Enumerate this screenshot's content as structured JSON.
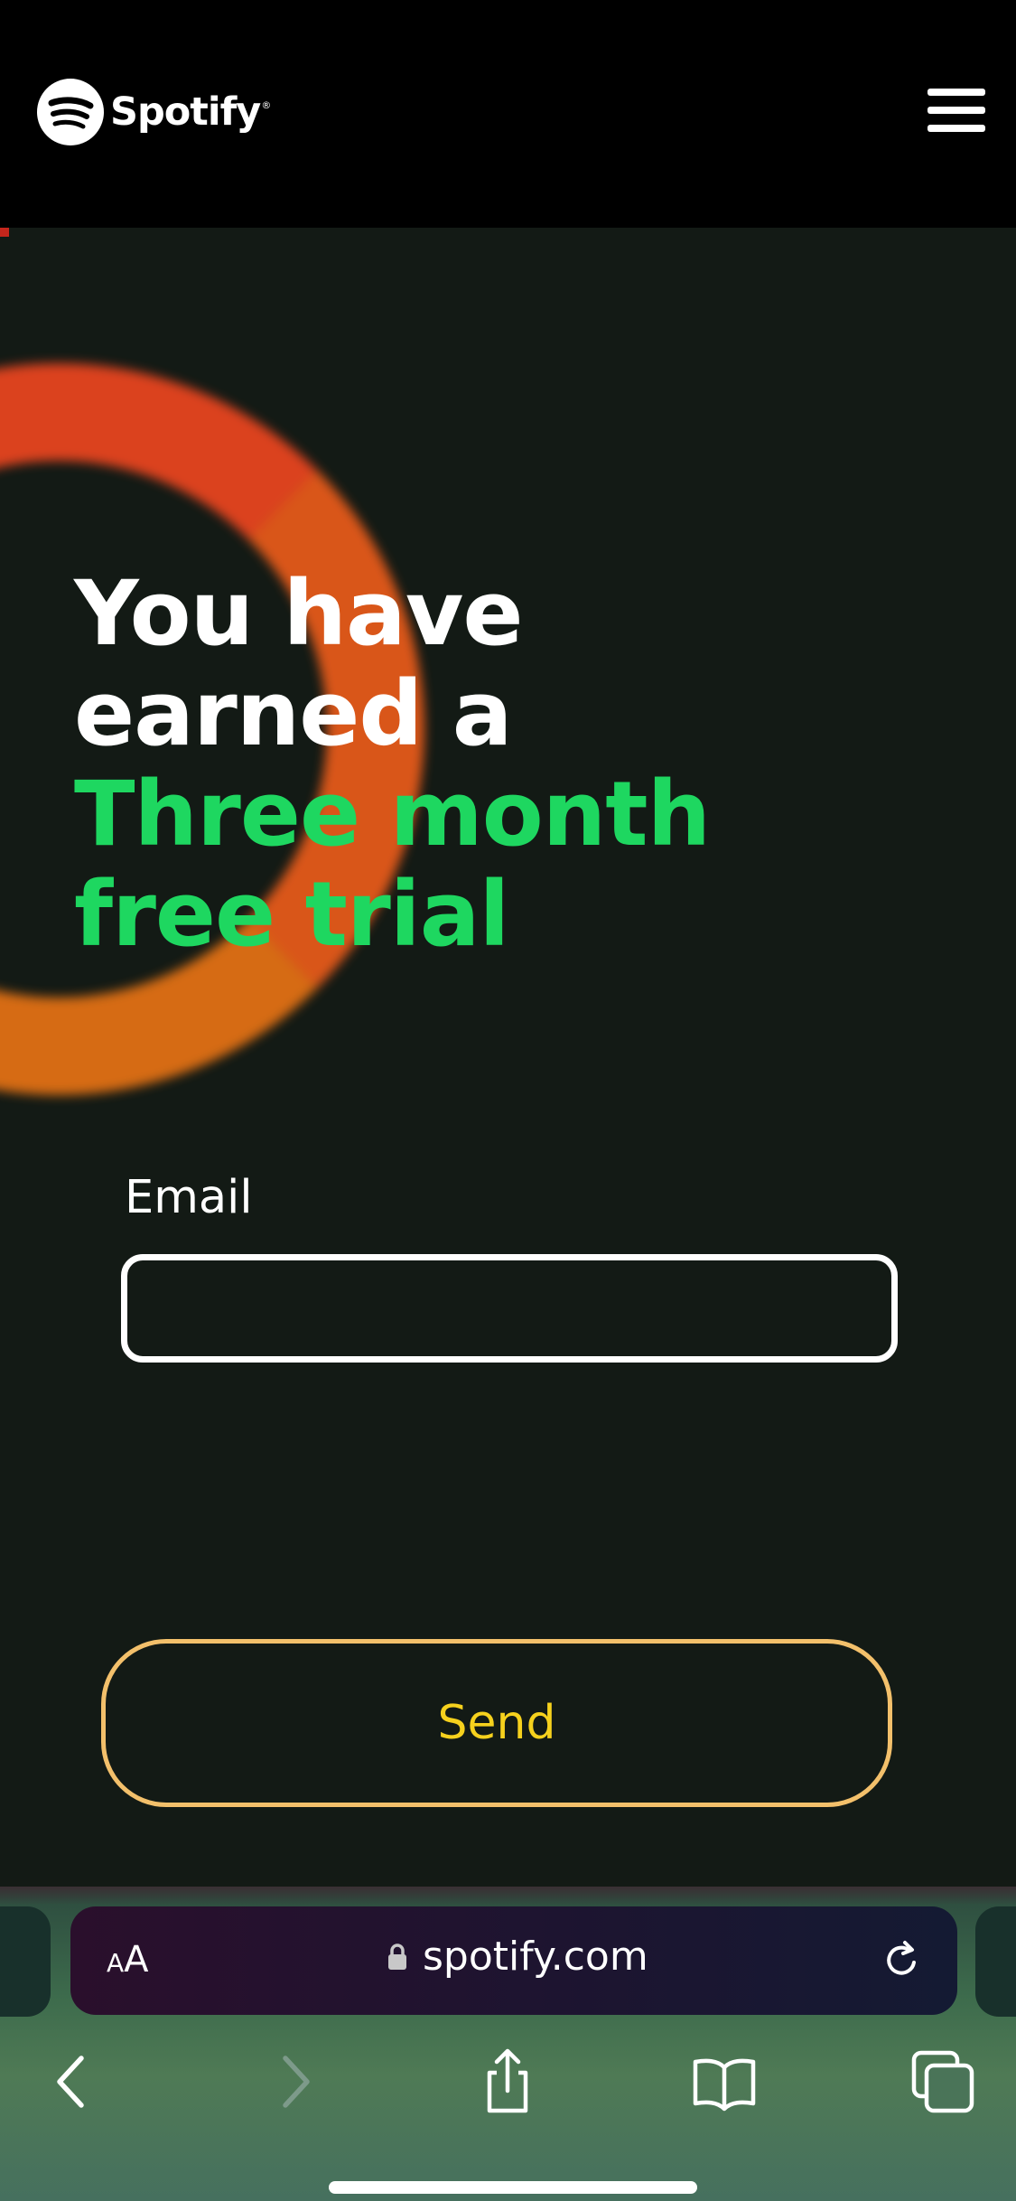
{
  "header": {
    "brand": "Spotify",
    "registered_mark": "®",
    "logo_icon": "spotify-logo-icon",
    "menu_icon": "hamburger-menu-icon"
  },
  "hero": {
    "line1": "You have",
    "line2": "earned a",
    "line3": "Three month",
    "line4": "free trial"
  },
  "form": {
    "email_label": "Email",
    "email_value": "",
    "email_placeholder": "",
    "send_label": "Send"
  },
  "browser": {
    "text_size_label_small": "A",
    "text_size_label_large": "A",
    "url": "spotify.com",
    "icons": [
      "lock-icon",
      "reload-icon",
      "back-icon",
      "forward-icon",
      "share-icon",
      "bookmarks-icon",
      "tabs-icon"
    ]
  },
  "colors": {
    "accent_green": "#1ed760",
    "send_text": "#f6d11d",
    "send_border": "#f3c06b",
    "background": "#131a15",
    "ring": "#e4491d"
  }
}
